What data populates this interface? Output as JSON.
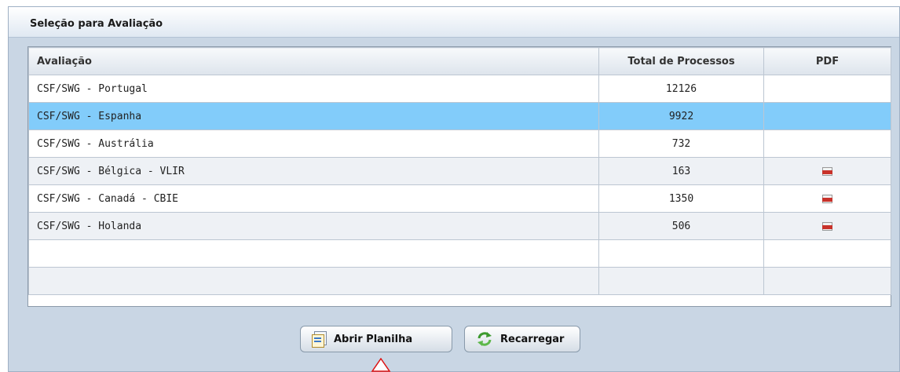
{
  "panel": {
    "title": "Seleção para Avaliação"
  },
  "table": {
    "columns": [
      "Avaliação",
      "Total de Processos",
      "PDF"
    ],
    "rows": [
      {
        "avaliacao": "CSF/SWG - Portugal",
        "total": "12126",
        "pdf": false,
        "selected": false
      },
      {
        "avaliacao": "CSF/SWG - Espanha",
        "total": "9922",
        "pdf": false,
        "selected": true
      },
      {
        "avaliacao": "CSF/SWG - Austrália",
        "total": "732",
        "pdf": false,
        "selected": false
      },
      {
        "avaliacao": "CSF/SWG - Bélgica - VLIR",
        "total": "163",
        "pdf": true,
        "selected": false
      },
      {
        "avaliacao": "CSF/SWG - Canadá - CBIE",
        "total": "1350",
        "pdf": true,
        "selected": false
      },
      {
        "avaliacao": "CSF/SWG - Holanda",
        "total": "506",
        "pdf": true,
        "selected": false
      },
      {
        "avaliacao": "",
        "total": "",
        "pdf": false,
        "selected": false
      },
      {
        "avaliacao": "",
        "total": "",
        "pdf": false,
        "selected": false
      }
    ]
  },
  "buttons": {
    "open_label": "Abrir Planilha",
    "reload_label": "Recarregar"
  },
  "colors": {
    "selected_row": "#82ccfa",
    "panel_bg": "#c9d6e4"
  },
  "icons": {
    "pdf": "pdf-file-icon",
    "open": "spreadsheet-icon",
    "reload": "refresh-icon"
  }
}
